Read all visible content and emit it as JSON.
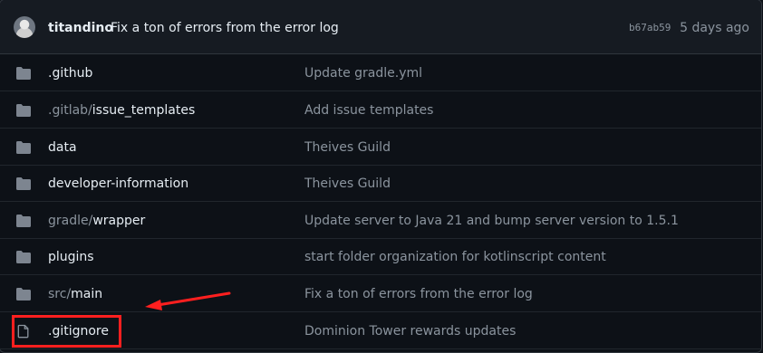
{
  "commit": {
    "author": "titandino",
    "message": "Fix a ton of errors from the error log",
    "sha": "b67ab59",
    "time": "5 days ago"
  },
  "files": [
    {
      "type": "folder",
      "icon": "folder-icon",
      "prefix": "",
      "name": ".github",
      "message": "Update gradle.yml"
    },
    {
      "type": "folder",
      "icon": "folder-icon",
      "prefix": ".gitlab/",
      "name": "issue_templates",
      "message": "Add issue templates"
    },
    {
      "type": "folder",
      "icon": "folder-icon",
      "prefix": "",
      "name": "data",
      "message": "Theives Guild"
    },
    {
      "type": "folder",
      "icon": "folder-icon",
      "prefix": "",
      "name": "developer-information",
      "message": "Theives Guild"
    },
    {
      "type": "folder",
      "icon": "folder-icon",
      "prefix": "gradle/",
      "name": "wrapper",
      "message": "Update server to Java 21 and bump server version to 1.5.1"
    },
    {
      "type": "folder",
      "icon": "folder-icon",
      "prefix": "",
      "name": "plugins",
      "message": "start folder organization for kotlinscript content"
    },
    {
      "type": "folder",
      "icon": "folder-icon",
      "prefix": "src/",
      "name": "main",
      "message": "Fix a ton of errors from the error log"
    },
    {
      "type": "file",
      "icon": "file-icon",
      "prefix": "",
      "name": ".gitignore",
      "message": "Dominion Tower rewards updates"
    }
  ],
  "annotation": {
    "highlight_color": "#ff1f1f",
    "highlighted_file": ".gitignore"
  },
  "colors": {
    "background": "#0d1117",
    "header_background": "#161b22",
    "text": "#e6edf3",
    "muted_text": "#8b949e",
    "folder_icon": "#7d8590"
  }
}
